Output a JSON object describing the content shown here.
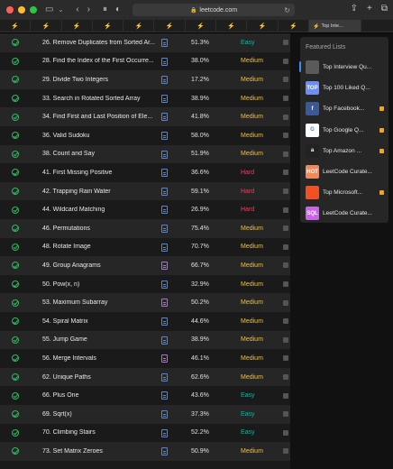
{
  "browser": {
    "url": "leetcode.com",
    "active_tab_label": "Top Inte...",
    "traffic_colors": [
      "#ff5f57",
      "#febc2e",
      "#28c840"
    ]
  },
  "tabs_count": 10,
  "problems": [
    {
      "title": "26. Remove Duplicates from Sorted Ar...",
      "acceptance": "51.3%",
      "difficulty": "Easy",
      "doc": "blue"
    },
    {
      "title": "28. Find the Index of the First Occurre...",
      "acceptance": "38.0%",
      "difficulty": "Medium",
      "doc": "blue"
    },
    {
      "title": "29. Divide Two Integers",
      "acceptance": "17.2%",
      "difficulty": "Medium",
      "doc": "blue"
    },
    {
      "title": "33. Search in Rotated Sorted Array",
      "acceptance": "38.9%",
      "difficulty": "Medium",
      "doc": "blue"
    },
    {
      "title": "34. Find First and Last Position of Ele...",
      "acceptance": "41.8%",
      "difficulty": "Medium",
      "doc": "blue"
    },
    {
      "title": "36. Valid Sudoku",
      "acceptance": "58.0%",
      "difficulty": "Medium",
      "doc": "blue"
    },
    {
      "title": "38. Count and Say",
      "acceptance": "51.9%",
      "difficulty": "Medium",
      "doc": "blue"
    },
    {
      "title": "41. First Missing Positive",
      "acceptance": "36.6%",
      "difficulty": "Hard",
      "doc": "blue"
    },
    {
      "title": "42. Trapping Rain Water",
      "acceptance": "59.1%",
      "difficulty": "Hard",
      "doc": "blue"
    },
    {
      "title": "44. Wildcard Matching",
      "acceptance": "26.9%",
      "difficulty": "Hard",
      "doc": "blue"
    },
    {
      "title": "46. Permutations",
      "acceptance": "75.4%",
      "difficulty": "Medium",
      "doc": "blue"
    },
    {
      "title": "48. Rotate Image",
      "acceptance": "70.7%",
      "difficulty": "Medium",
      "doc": "blue"
    },
    {
      "title": "49. Group Anagrams",
      "acceptance": "66.7%",
      "difficulty": "Medium",
      "doc": "purple"
    },
    {
      "title": "50. Pow(x, n)",
      "acceptance": "32.9%",
      "difficulty": "Medium",
      "doc": "blue"
    },
    {
      "title": "53. Maximum Subarray",
      "acceptance": "50.2%",
      "difficulty": "Medium",
      "doc": "purple"
    },
    {
      "title": "54. Spiral Matrix",
      "acceptance": "44.6%",
      "difficulty": "Medium",
      "doc": "blue"
    },
    {
      "title": "55. Jump Game",
      "acceptance": "38.9%",
      "difficulty": "Medium",
      "doc": "blue"
    },
    {
      "title": "56. Merge Intervals",
      "acceptance": "46.1%",
      "difficulty": "Medium",
      "doc": "purple"
    },
    {
      "title": "62. Unique Paths",
      "acceptance": "62.6%",
      "difficulty": "Medium",
      "doc": "blue"
    },
    {
      "title": "66. Plus One",
      "acceptance": "43.6%",
      "difficulty": "Easy",
      "doc": "blue"
    },
    {
      "title": "69. Sqrt(x)",
      "acceptance": "37.3%",
      "difficulty": "Easy",
      "doc": "blue"
    },
    {
      "title": "70. Climbing Stairs",
      "acceptance": "52.2%",
      "difficulty": "Easy",
      "doc": "blue"
    },
    {
      "title": "73. Set Matrix Zeroes",
      "acceptance": "50.9%",
      "difficulty": "Medium",
      "doc": "blue"
    }
  ],
  "featured": {
    "title": "Featured Lists",
    "items": [
      {
        "name": "Top Interview Qu...",
        "thumb_text": "",
        "thumb_color": "#5a5a5a",
        "locked": false,
        "active": true
      },
      {
        "name": "Top 100 Liked Q...",
        "thumb_text": "TOP",
        "thumb_color": "#6c8ef5",
        "locked": false,
        "active": false
      },
      {
        "name": "Top Facebook...",
        "thumb_text": "f",
        "thumb_color": "#3b5998",
        "locked": true,
        "active": false
      },
      {
        "name": "Top Google Q...",
        "thumb_text": "G",
        "thumb_color": "#ffffff",
        "locked": true,
        "active": false
      },
      {
        "name": "Top Amazon ...",
        "thumb_text": "a",
        "thumb_color": "#222222",
        "locked": true,
        "active": false
      },
      {
        "name": "LeetCode Curate...",
        "thumb_text": "HOT",
        "thumb_color": "#f08a5d",
        "locked": false,
        "active": false
      },
      {
        "name": "Top Microsoft...",
        "thumb_text": "",
        "thumb_color": "#f25022",
        "locked": true,
        "active": false
      },
      {
        "name": "LeetCode Curate...",
        "thumb_text": "SQL",
        "thumb_color": "#c964e6",
        "locked": false,
        "active": false
      }
    ]
  }
}
